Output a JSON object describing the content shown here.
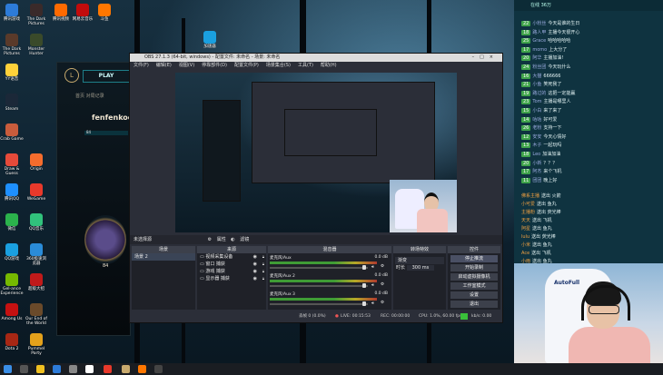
{
  "desktop": {
    "icons": [
      {
        "label": "腾讯游戏",
        "color": "#2d7bd8"
      },
      {
        "label": "The Dark Pictures",
        "color": "#5a3a2a"
      },
      {
        "label": "YY语音",
        "color": "#ffd23a"
      },
      {
        "label": "Steam",
        "color": "#1b2838"
      },
      {
        "label": "Crab Game",
        "color": "#c85c3c"
      },
      {
        "label": "Draw & Guess",
        "color": "#e64a3a"
      },
      {
        "label": "腾讯QQ",
        "color": "#1e90ff"
      },
      {
        "label": "微信",
        "color": "#2bb24c"
      },
      {
        "label": "QQ游戏",
        "color": "#1aa0e0"
      },
      {
        "label": "Gel-ance Experience",
        "color": "#76b900"
      },
      {
        "label": "Among Us",
        "color": "#c51111"
      },
      {
        "label": "Dota 2",
        "color": "#a72714"
      }
    ],
    "icons_col2": [
      {
        "label": "The Dark Pictures",
        "color": "#3a2a2a"
      },
      {
        "label": "Monster Hunter",
        "color": "#3a4a2a"
      },
      {
        "label": "Origin",
        "color": "#f56c2d"
      },
      {
        "label": "WeGame",
        "color": "#e8392b"
      },
      {
        "label": "QQ音乐",
        "color": "#31c27c"
      },
      {
        "label": "360极速浏览器",
        "color": "#2a8cd8"
      },
      {
        "label": "超级大招",
        "color": "#c01a1a"
      },
      {
        "label": "Our End of the World",
        "color": "#6a4a2a"
      },
      {
        "label": "Pummel Party",
        "color": "#e4a11b"
      }
    ],
    "top_icons": [
      {
        "label": "腾讯视频",
        "color": "#ff6a00"
      },
      {
        "label": "网易云音乐",
        "color": "#c20c0c"
      },
      {
        "label": "斗鱼",
        "color": "#ff7700"
      },
      {
        "label": "加速器",
        "color": "#1aa0e0"
      }
    ]
  },
  "lol": {
    "play_label": "PLAY",
    "nav": "首页   对局记录",
    "summoner": "fenfenkoo",
    "level": "84",
    "emblem_level": "84"
  },
  "obs": {
    "title": "OBS 27.1.3 (64-bit, windows) - 配置文件: 未命名 - 场景: 未命名",
    "menu": [
      "文件(F)",
      "编辑(E)",
      "视图(V)",
      "停靠部件(D)",
      "配置文件(P)",
      "场景集合(S)",
      "工具(T)",
      "帮助(H)"
    ],
    "scene_bar_left": "未选择源",
    "scene_bar_props": "属性",
    "scene_bar_filters": "滤镜",
    "panels": {
      "scenes_title": "场景",
      "sources_title": "来源",
      "mixer_title": "混音器",
      "transitions_title": "转场特效",
      "controls_title": "控件"
    },
    "scenes": [
      "场景 2"
    ],
    "sources": [
      "视频采集设备",
      "窗口 捕获",
      "游戏 捕获",
      "显示器 捕获"
    ],
    "mixer": [
      {
        "name": "麦克风/Aux",
        "db": "0.0 dB"
      },
      {
        "name": "麦克风/Aux 2",
        "db": "0.0 dB"
      },
      {
        "name": "麦克风/Aux 3",
        "db": "0.0 dB"
      }
    ],
    "transition": {
      "type": "渐变",
      "duration_label": "时长",
      "duration": "300 ms"
    },
    "controls": [
      "停止推流",
      "开始录制",
      "启动虚拟摄像机",
      "工作室模式",
      "设置",
      "退出"
    ],
    "status": {
      "dropped": "丢帧 0 (0.0%)",
      "live": "LIVE: 00:15:53",
      "rec": "REC: 00:00:00",
      "cpu": "CPU: 1.0%, 60.00 fps",
      "kbps": "kb/s: 0.00"
    }
  },
  "chat": {
    "header": "在线 36万",
    "messages": [
      {
        "badge": "22",
        "nick": "小粉丝",
        "text": "今天是谁的生日"
      },
      {
        "badge": "18",
        "nick": "路人甲",
        "text": "主播今天很开心"
      },
      {
        "badge": "25",
        "nick": "Grace",
        "text": "哈哈哈哈哈"
      },
      {
        "badge": "17",
        "nick": "momo",
        "text": "上大分了"
      },
      {
        "badge": "20",
        "nick": "阿华",
        "text": "主播加油!"
      },
      {
        "badge": "24",
        "nick": "粉丝团",
        "text": "今天玩什么"
      },
      {
        "badge": "16",
        "nick": "大猫",
        "text": "666666"
      },
      {
        "badge": "21",
        "nick": "小鱼",
        "text": "笑死我了"
      },
      {
        "badge": "19",
        "nick": "路过的",
        "text": "这把一定能赢"
      },
      {
        "badge": "23",
        "nick": "Tom",
        "text": "主播是哪里人"
      },
      {
        "badge": "15",
        "nick": "小白",
        "text": "来了来了"
      },
      {
        "badge": "14",
        "nick": "咕咕",
        "text": "好可爱"
      },
      {
        "badge": "26",
        "nick": "老粉",
        "text": "支持一下"
      },
      {
        "badge": "12",
        "nick": "安安",
        "text": "今天心情好"
      },
      {
        "badge": "13",
        "nick": "木子",
        "text": "一起玩吗"
      },
      {
        "badge": "18",
        "nick": "Leo",
        "text": "加油加油"
      },
      {
        "badge": "20",
        "nick": "小新",
        "text": "？？？"
      },
      {
        "badge": "17",
        "nick": "阿杰",
        "text": "来个飞机"
      },
      {
        "badge": "11",
        "nick": "团团",
        "text": "晚上好"
      }
    ],
    "gifts": [
      {
        "nick": "佛系主播",
        "text": "送出 火箭"
      },
      {
        "nick": "小可爱",
        "text": "送出 鱼丸"
      },
      {
        "nick": "主播粉",
        "text": "送出 荧光棒"
      },
      {
        "nick": "天天",
        "text": "送出 飞机"
      },
      {
        "nick": "阿星",
        "text": "送出 鱼丸"
      },
      {
        "nick": "lulu",
        "text": "送出 荧光棒"
      },
      {
        "nick": "小米",
        "text": "送出 鱼丸"
      },
      {
        "nick": "Ace",
        "text": "送出 飞机"
      },
      {
        "nick": "小雨",
        "text": "送出 鱼丸"
      }
    ],
    "webcam_brand": "AutoFull"
  }
}
